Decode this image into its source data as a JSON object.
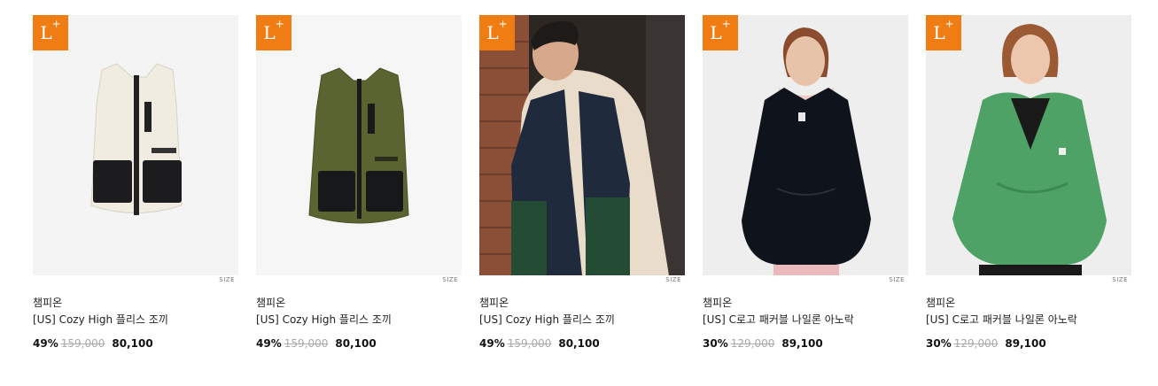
{
  "badge": {
    "main": "L",
    "sup": "+"
  },
  "size_label": "SIZE",
  "colors": {
    "badge": "#f07d14"
  },
  "products": [
    {
      "brand": "챔피온",
      "name": "[US] Cozy High 플리스 조끼",
      "discount": "49%",
      "original_price": "159,000",
      "price": "80,100",
      "image": "ivory-fleece-vest"
    },
    {
      "brand": "챔피온",
      "name": "[US] Cozy High 플리스 조끼",
      "discount": "49%",
      "original_price": "159,000",
      "price": "80,100",
      "image": "olive-fleece-vest"
    },
    {
      "brand": "챔피온",
      "name": "[US] Cozy High 플리스 조끼",
      "discount": "49%",
      "original_price": "159,000",
      "price": "80,100",
      "image": "model-navy-vest"
    },
    {
      "brand": "챔피온",
      "name": "[US] C로고 패커블 나일론 아노락",
      "discount": "30%",
      "original_price": "129,000",
      "price": "89,100",
      "image": "model-black-anorak"
    },
    {
      "brand": "챔피온",
      "name": "[US] C로고 패커블 나일론 아노락",
      "discount": "30%",
      "original_price": "129,000",
      "price": "89,100",
      "image": "model-green-anorak"
    }
  ]
}
